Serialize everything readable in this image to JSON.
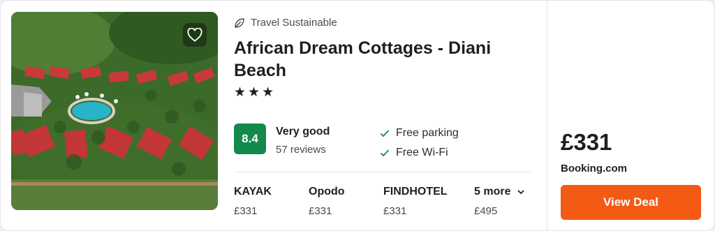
{
  "hotel": {
    "sustainability_label": "Travel Sustainable",
    "name": "African Dream Cottages - Diani Beach",
    "stars": "★★★",
    "star_count": 3,
    "score": "8.4",
    "rating_label": "Very good",
    "reviews": "57 reviews",
    "amenities": [
      "Free parking",
      "Free Wi-Fi"
    ]
  },
  "providers": [
    {
      "name": "KAYAK",
      "price": "£331"
    },
    {
      "name": "Opodo",
      "price": "£331"
    },
    {
      "name": "FINDHOTEL",
      "price": "£331"
    }
  ],
  "more_providers": {
    "label": "5 more",
    "price": "£495"
  },
  "best_deal": {
    "price": "£331",
    "site": "Booking.com",
    "button_label": "View Deal"
  },
  "colors": {
    "score_bg": "#138a4b",
    "deal_button": "#f35a14",
    "check": "#138a4b"
  },
  "icons": {
    "sustainability": "leaf-icon",
    "favorite": "heart-icon",
    "amenity": "check-icon",
    "more": "chevron-down-icon"
  }
}
